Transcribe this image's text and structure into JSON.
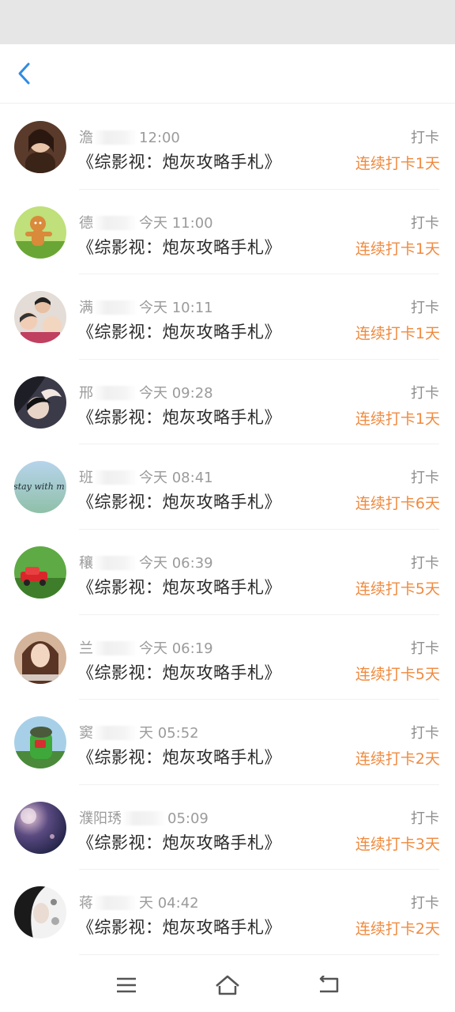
{
  "header": {
    "back_icon": "chevron-left-icon",
    "accent": "#2d8ce4"
  },
  "rows": [
    {
      "name": "澹",
      "time": "12:00",
      "title": "《综影视：炮灰攻略手札》",
      "action": "打卡",
      "streak": "连续打卡1天",
      "avatar_color": "#5a3a2a"
    },
    {
      "name": "德",
      "time": "今天 11:00",
      "title": "《综影视：炮灰攻略手札》",
      "action": "打卡",
      "streak": "连续打卡1天",
      "avatar_color": "#8cbf4a"
    },
    {
      "name": "满",
      "time": "今天 10:11",
      "title": "《综影视：炮灰攻略手札》",
      "action": "打卡",
      "streak": "连续打卡1天",
      "avatar_color": "#d8c8c0"
    },
    {
      "name": "邢",
      "time": "今天 09:28",
      "title": "《综影视：炮灰攻略手札》",
      "action": "打卡",
      "streak": "连续打卡1天",
      "avatar_color": "#3a3a48"
    },
    {
      "name": "班",
      "time": "今天 08:41",
      "title": "《综影视：炮灰攻略手札》",
      "action": "打卡",
      "streak": "连续打卡6天",
      "avatar_color": "#9fc3e0",
      "avatar_text": "stay with m"
    },
    {
      "name": "穰",
      "time": "今天 06:39",
      "title": "《综影视：炮灰攻略手札》",
      "action": "打卡",
      "streak": "连续打卡5天",
      "avatar_color": "#4a9a3a"
    },
    {
      "name": "兰",
      "time": "今天 06:19",
      "title": "《综影视：炮灰攻略手札》",
      "action": "打卡",
      "streak": "连续打卡5天",
      "avatar_color": "#c8a488"
    },
    {
      "name": "窦",
      "time": "天 05:52",
      "title": "《综影视：炮灰攻略手札》",
      "action": "打卡",
      "streak": "连续打卡2天",
      "avatar_color": "#3f8f3a"
    },
    {
      "name": "濮阳琇",
      "time": "05:09",
      "title": "《综影视：炮灰攻略手札》",
      "action": "打卡",
      "streak": "连续打卡3天",
      "avatar_color": "#1e2650"
    },
    {
      "name": "蒋",
      "time": "天 04:42",
      "title": "《综影视：炮灰攻略手札》",
      "action": "打卡",
      "streak": "连续打卡2天",
      "avatar_color": "#2a2a2a"
    }
  ],
  "navbar": {
    "menu_icon": "menu-icon",
    "home_icon": "home-icon",
    "back_icon": "return-icon"
  }
}
